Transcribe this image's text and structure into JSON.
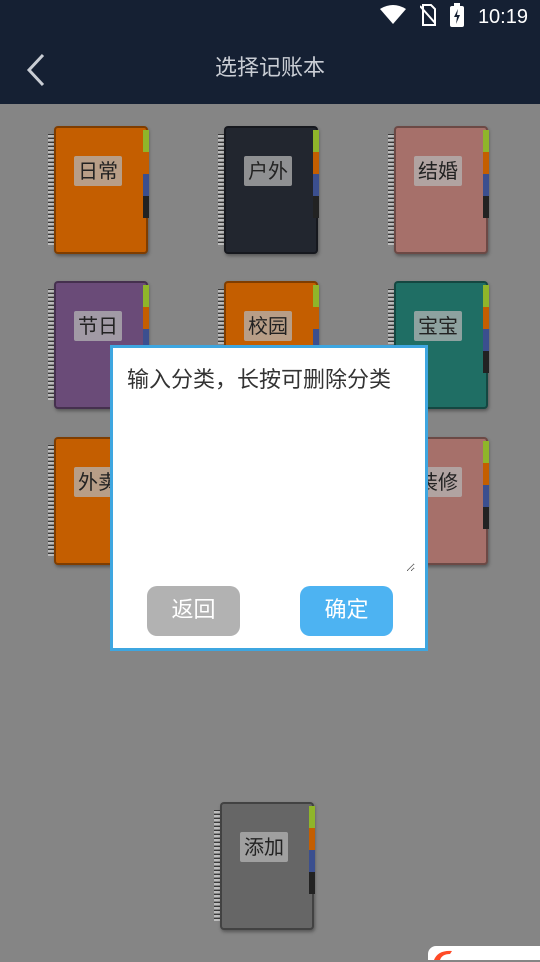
{
  "status_bar": {
    "time": "10:19",
    "icons": [
      "wifi-icon",
      "no-sim-icon",
      "battery-charging-icon"
    ]
  },
  "header": {
    "title": "选择记账本",
    "back_icon": "back-chevron-icon"
  },
  "notebooks": [
    {
      "label": "日常",
      "color": "#c45e00"
    },
    {
      "label": "户外",
      "color": "#22262f"
    },
    {
      "label": "结婚",
      "color": "#a6706a"
    },
    {
      "label": "节日",
      "color": "#6a4b78"
    },
    {
      "label": "校园",
      "color": "#c45e00"
    },
    {
      "label": "宝宝",
      "color": "#1f6e64"
    },
    {
      "label": "外卖",
      "color": "#c45e00"
    },
    {
      "label": "装修",
      "color": "#a6706a"
    }
  ],
  "add_notebook": {
    "label": "添加",
    "color": "#666666"
  },
  "dialog": {
    "title": "输入分类，长按可删除分类",
    "input_value": "",
    "cancel_label": "返回",
    "confirm_label": "确定"
  },
  "colors": {
    "header_bg": "#152033",
    "overlay": "#858585",
    "dialog_border": "#3ea6e0",
    "confirm_button": "#4db3f2",
    "cancel_button": "#b2b2b2"
  }
}
